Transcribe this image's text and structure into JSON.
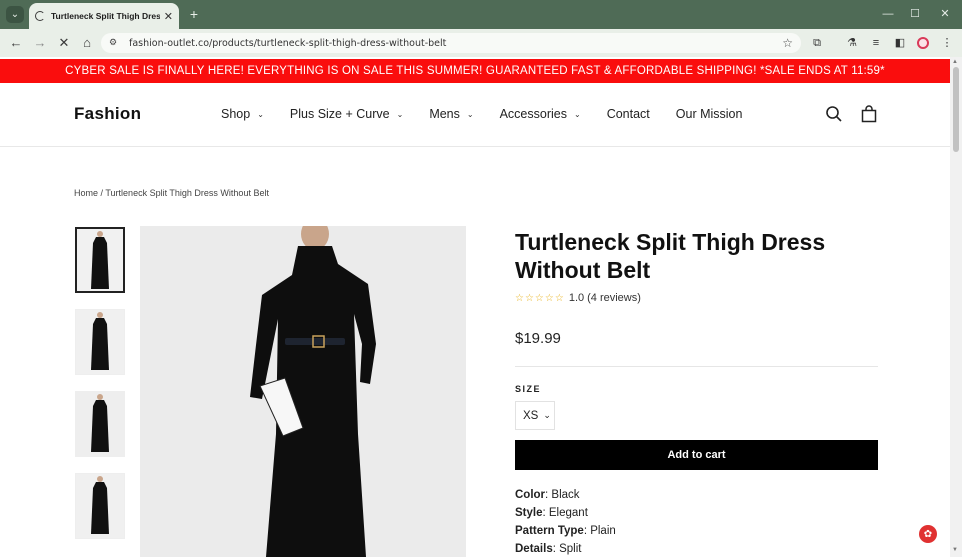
{
  "browser": {
    "tab_title": "Turtleneck Split Thigh Dress W",
    "url": "fashion-outlet.co/products/turtleneck-split-thigh-dress-without-belt"
  },
  "promo_bar": {
    "text": "CYBER SALE IS FINALLY HERE! EVERYTHING IS ON SALE THIS SUMMER! GUARANTEED FAST & AFFORDABLE SHIPPING! *SALE ENDS AT 11:59*"
  },
  "header": {
    "logo": "Fashion",
    "nav": [
      {
        "label": "Shop"
      },
      {
        "label": "Plus Size + Curve"
      },
      {
        "label": "Mens"
      },
      {
        "label": "Accessories"
      },
      {
        "label": "Contact"
      },
      {
        "label": "Our Mission"
      }
    ]
  },
  "breadcrumb": {
    "home": "Home",
    "separator": "/",
    "current": "Turtleneck Split Thigh Dress Without Belt"
  },
  "product": {
    "title": "Turtleneck Split Thigh Dress Without Belt",
    "stars": "☆☆☆☆☆",
    "rating": "1.0",
    "reviews": "(4 reviews)",
    "price": "$19.99",
    "size_label": "SIZE",
    "size_value": "XS",
    "add_to_cart": "Add to cart",
    "specs": [
      {
        "key": "Color",
        "value": "Black"
      },
      {
        "key": "Style",
        "value": "Elegant"
      },
      {
        "key": "Pattern Type",
        "value": "Plain"
      },
      {
        "key": "Details",
        "value": "Split"
      }
    ]
  },
  "colors": {
    "promo_red": "#fa0d0d",
    "cart_button": "#000000",
    "chrome_green": "#4f6b56"
  }
}
